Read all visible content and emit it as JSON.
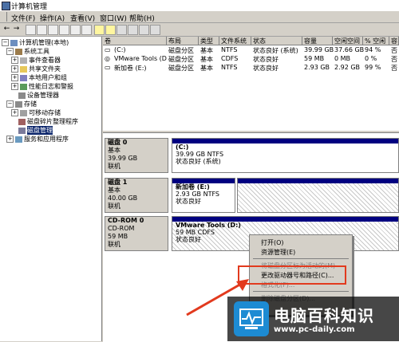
{
  "window": {
    "title": "计算机管理"
  },
  "menu": [
    "文件(F)",
    "操作(A)",
    "查看(V)",
    "窗口(W)",
    "帮助(H)"
  ],
  "tree": [
    {
      "label": "计算机管理(本地)",
      "depth": 0,
      "exp": "−"
    },
    {
      "label": "系统工具",
      "depth": 1,
      "exp": "−"
    },
    {
      "label": "事件查看器",
      "depth": 2,
      "exp": "+"
    },
    {
      "label": "共享文件夹",
      "depth": 2,
      "exp": "+"
    },
    {
      "label": "本地用户和组",
      "depth": 2,
      "exp": "+"
    },
    {
      "label": "性能日志和警报",
      "depth": 2,
      "exp": "+"
    },
    {
      "label": "设备管理器",
      "depth": 2,
      "exp": ""
    },
    {
      "label": "存储",
      "depth": 1,
      "exp": "−"
    },
    {
      "label": "可移动存储",
      "depth": 2,
      "exp": "+"
    },
    {
      "label": "磁盘碎片整理程序",
      "depth": 2,
      "exp": ""
    },
    {
      "label": "磁盘管理",
      "depth": 2,
      "exp": "",
      "selected": true
    },
    {
      "label": "服务和应用程序",
      "depth": 1,
      "exp": "+"
    }
  ],
  "volumes": {
    "headers": [
      "卷",
      "布局",
      "类型",
      "文件系统",
      "状态",
      "容量",
      "空闲空间",
      "% 空闲",
      "容"
    ],
    "rows": [
      [
        "(C:)",
        "磁盘分区",
        "基本",
        "NTFS",
        "状态良好 (系统)",
        "39.99 GB",
        "37.66 GB",
        "94 %",
        "否"
      ],
      [
        "VMware Tools (D:)",
        "磁盘分区",
        "基本",
        "CDFS",
        "状态良好",
        "59 MB",
        "0 MB",
        "0 %",
        "否"
      ],
      [
        "新加卷 (E:)",
        "磁盘分区",
        "基本",
        "NTFS",
        "状态良好",
        "2.93 GB",
        "2.92 GB",
        "99 %",
        "否"
      ]
    ]
  },
  "disks": [
    {
      "name": "磁盘 0",
      "type": "基本",
      "size": "39.99 GB",
      "status": "联机",
      "part_name": "(C:)",
      "part_size": "39.99 GB NTFS",
      "part_status": "状态良好 (系统)"
    },
    {
      "name": "磁盘 1",
      "type": "基本",
      "size": "40.00 GB",
      "status": "联机",
      "part_name": "新加卷 (E:)",
      "part_size": "2.93 GB NTFS",
      "part_status": "状态良好"
    },
    {
      "name": "CD-ROM 0",
      "type": "CD-ROM",
      "size": "59 MB",
      "status": "联机",
      "part_name": "VMware Tools (D:)",
      "part_size": "59 MB CDFS",
      "part_status": "状态良好"
    }
  ],
  "context_menu": [
    {
      "label": "打开(O)",
      "disabled": false
    },
    {
      "label": "资源管理(E)",
      "disabled": false
    },
    {
      "label": "将磁盘分区标为活动的(M)",
      "disabled": true
    },
    {
      "label": "更改驱动器号和路径(C)...",
      "disabled": false
    },
    {
      "label": "格式化(F)...",
      "disabled": true
    },
    {
      "label": "删除磁盘分区(D)...",
      "disabled": true
    }
  ],
  "watermark": {
    "title": "电脑百科知识",
    "url": "www.pc-daily.com"
  },
  "colors": {
    "highlight_box": "#e23a1e",
    "partition_bar": "#000080",
    "selection": "#0a246a"
  }
}
